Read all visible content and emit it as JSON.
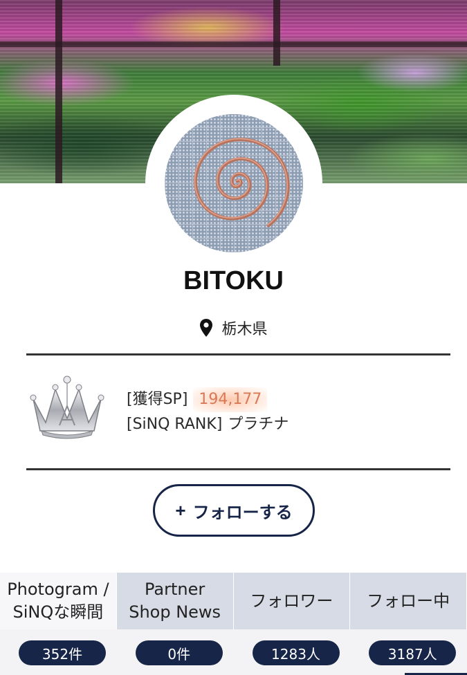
{
  "profile": {
    "name": "BITOKU",
    "location": "栃木県"
  },
  "rank": {
    "sp_label": "[獲得SP]",
    "sp_value": "194,177",
    "rank_label": "[SiNQ RANK]",
    "rank_value": "プラチナ"
  },
  "actions": {
    "follow_icon": "+",
    "follow_label": "フォローする"
  },
  "stats": [
    {
      "label_line1": "Photogram /",
      "label_line2": "SiNQな瞬間",
      "count": "352件"
    },
    {
      "label_line1": "Partner",
      "label_line2": "Shop News",
      "count": "0件"
    },
    {
      "label_line1": "フォロワー",
      "label_line2": "",
      "count": "1283人"
    },
    {
      "label_line1": "フォロー中",
      "label_line2": "",
      "count": "3187人"
    }
  ],
  "icons": {
    "location": "map-pin-icon",
    "rank": "crown-icon"
  },
  "colors": {
    "accent_navy": "#172648",
    "sp_highlight": "#d77a55",
    "tab_background": "#d6dbe5"
  }
}
